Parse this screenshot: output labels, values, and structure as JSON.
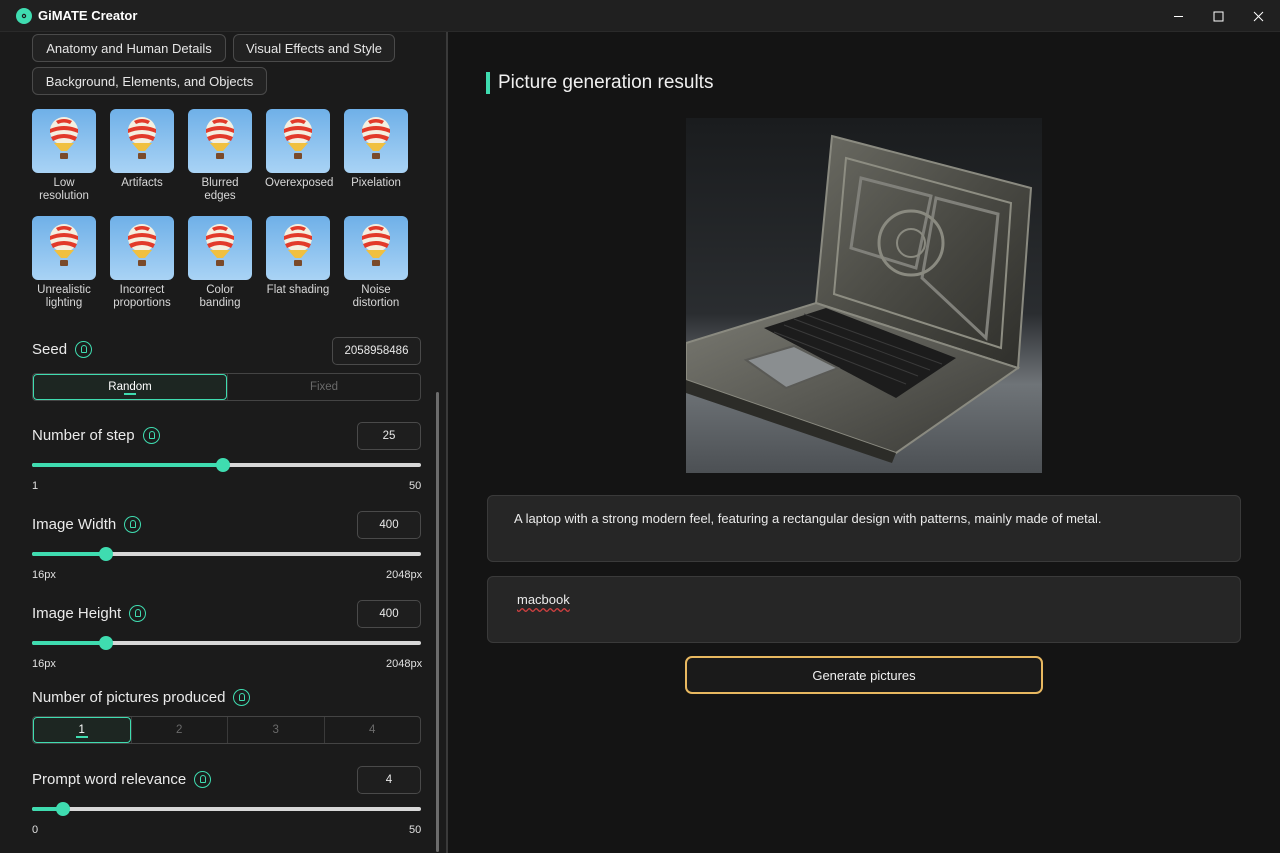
{
  "window": {
    "title": "GiMATE Creator"
  },
  "categories": [
    "Anatomy and Human Details",
    "Visual Effects and Style",
    "Background, Elements, and Objects"
  ],
  "negative_styles": [
    {
      "label": "Low resolution",
      "icon": "hot-air-balloon"
    },
    {
      "label": "Artifacts",
      "icon": "hot-air-balloon"
    },
    {
      "label": "Blurred edges",
      "icon": "hot-air-balloon"
    },
    {
      "label": "Overexposed",
      "icon": "hot-air-balloon"
    },
    {
      "label": "Pixelation",
      "icon": "hot-air-balloon"
    },
    {
      "label": "Unrealistic lighting",
      "icon": "hot-air-balloon"
    },
    {
      "label": "Incorrect proportions",
      "icon": "hot-air-balloon"
    },
    {
      "label": "Color banding",
      "icon": "hot-air-balloon"
    },
    {
      "label": "Flat shading",
      "icon": "hot-air-balloon"
    },
    {
      "label": "Noise distortion",
      "icon": "hot-air-balloon"
    }
  ],
  "seed": {
    "label": "Seed",
    "value": "2058958486",
    "modes": [
      "Random",
      "Fixed"
    ],
    "selected": "Random"
  },
  "steps": {
    "label": "Number of step",
    "value": "25",
    "min": "1",
    "max": "50",
    "fraction": 0.49
  },
  "width": {
    "label": "Image Width",
    "value": "400",
    "min": "16px",
    "max": "2048px",
    "fraction": 0.19
  },
  "height": {
    "label": "Image Height",
    "value": "400",
    "min": "16px",
    "max": "2048px",
    "fraction": 0.19
  },
  "pictures": {
    "label": "Number of pictures produced",
    "options": [
      "1",
      "2",
      "3",
      "4"
    ],
    "selected": "1"
  },
  "relevance": {
    "label": "Prompt word relevance",
    "value": "4",
    "min": "0",
    "max": "50",
    "fraction": 0.08
  },
  "results": {
    "title": "Picture generation results",
    "description": "A laptop with a strong modern feel, featuring a rectangular design with patterns, mainly made of metal.",
    "prompt": "macbook",
    "generate_label": "Generate pictures"
  },
  "colors": {
    "accent": "#3fdcb0",
    "button_border": "#e8b860"
  }
}
